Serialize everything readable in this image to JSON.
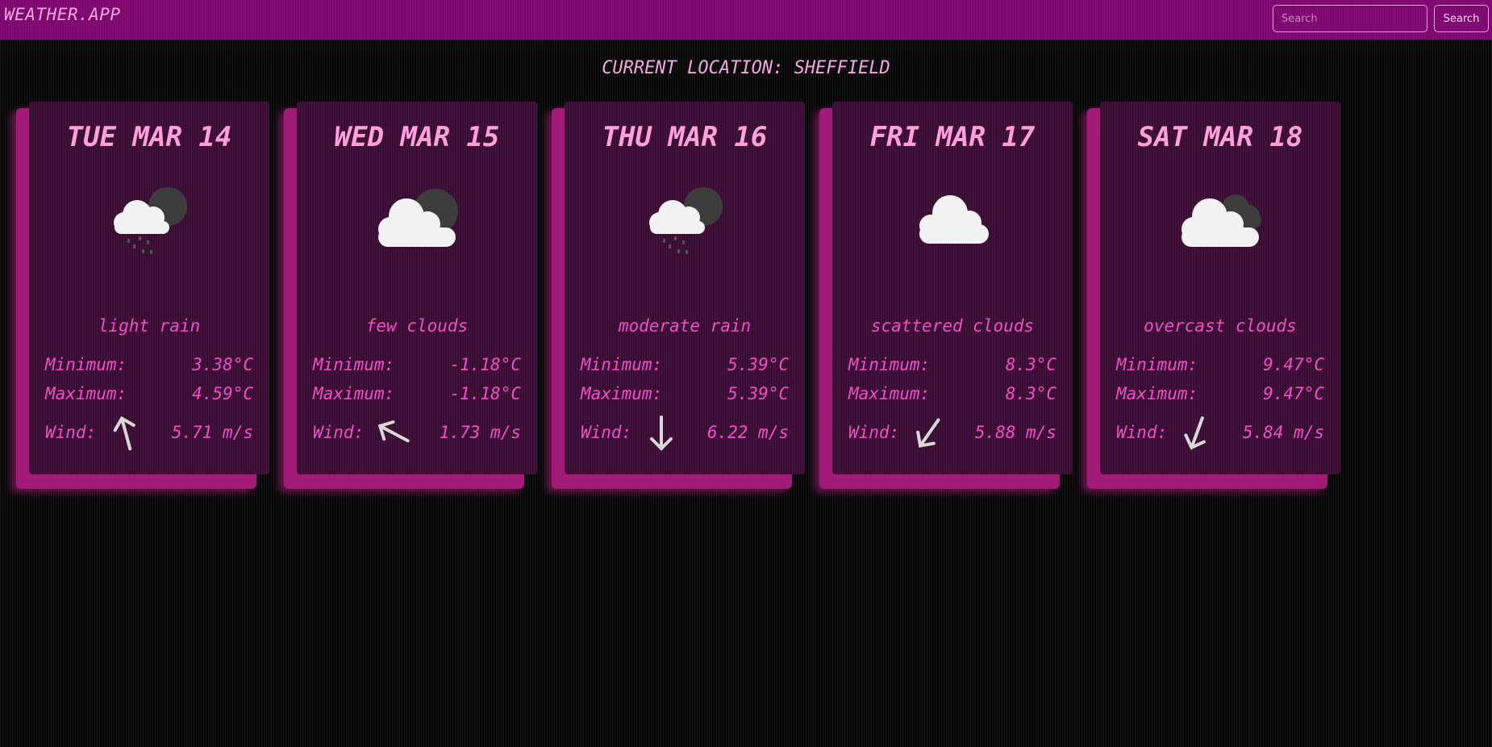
{
  "navbar": {
    "brand": "WEATHER.APP",
    "search_placeholder": "Search",
    "search_button": "Search"
  },
  "location_label": "CURRENT LOCATION: SHEFFIELD",
  "labels": {
    "min": "Minimum:",
    "max": "Maximum:",
    "wind": "Wind:"
  },
  "days": [
    {
      "date": "TUE MAR 14",
      "icon": "rain-cloud-night-icon",
      "description": "light rain",
      "min": "3.38°C",
      "max": "4.59°C",
      "wind": "5.71 m/s",
      "wind_arrow": "arrow-up-icon"
    },
    {
      "date": "WED MAR 15",
      "icon": "cloud-night-icon",
      "description": "few clouds",
      "min": "-1.18°C",
      "max": "-1.18°C",
      "wind": "1.73 m/s",
      "wind_arrow": "arrow-up-left-icon"
    },
    {
      "date": "THU MAR 16",
      "icon": "rain-cloud-night-icon",
      "description": "moderate rain",
      "min": "5.39°C",
      "max": "5.39°C",
      "wind": "6.22 m/s",
      "wind_arrow": "arrow-down-icon"
    },
    {
      "date": "FRI MAR 17",
      "icon": "cloud-icon",
      "description": "scattered clouds",
      "min": "8.3°C",
      "max": "8.3°C",
      "wind": "5.88 m/s",
      "wind_arrow": "arrow-down-left-icon"
    },
    {
      "date": "SAT MAR 18",
      "icon": "overcast-clouds-icon",
      "description": "overcast clouds",
      "min": "9.47°C",
      "max": "9.47°C",
      "wind": "5.84 m/s",
      "wind_arrow": "arrow-down-left-icon"
    }
  ],
  "colors": {
    "navbar": "#840a76",
    "accent": "#f04fc8",
    "card": "#3a0b33",
    "title": "#ff9fdc"
  }
}
